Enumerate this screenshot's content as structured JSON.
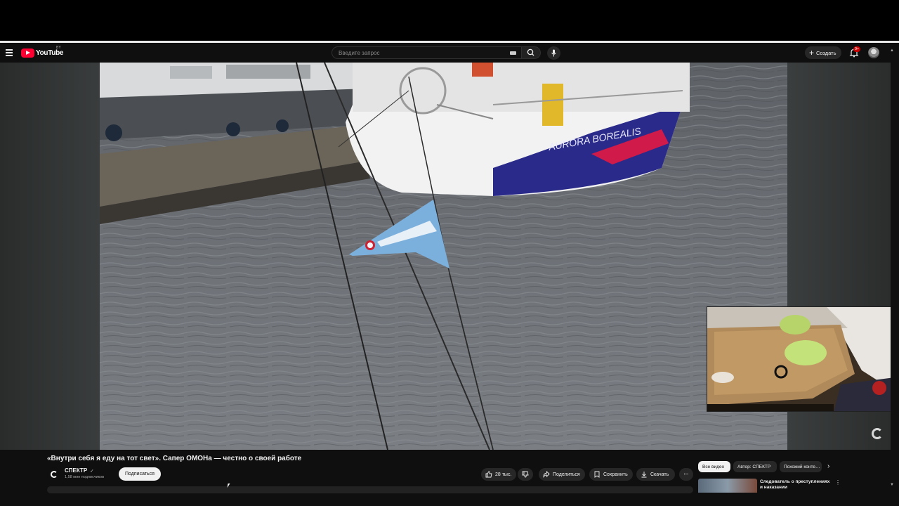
{
  "masthead": {
    "logo_text": "YouTube",
    "region": "BY",
    "search_placeholder": "Введите запрос",
    "create_label": "Создать",
    "notifications_badge": "9+"
  },
  "video": {
    "title": "«Внутри себя я еду на тот свет». Сапер ОМОНа — честно о своей работе",
    "boat_name": "AURORA BOREALIS"
  },
  "channel": {
    "name": "СПЕКТР",
    "verified_mark": "✓",
    "subscribers": "1,58 млн подписчиков",
    "subscribe_label": "Подписаться"
  },
  "actions": {
    "likes": "28 тыс.",
    "share": "Поделиться",
    "save": "Сохранить",
    "download": "Скачать",
    "more": "···"
  },
  "chips": [
    {
      "label": "Все видео",
      "active": true
    },
    {
      "label": "Автор: СПЕКТР",
      "active": false
    },
    {
      "label": "Похожий конте…",
      "active": false
    }
  ],
  "recommendation": {
    "title": "Следователь о преступлениях и наказании",
    "menu": "⋮"
  }
}
